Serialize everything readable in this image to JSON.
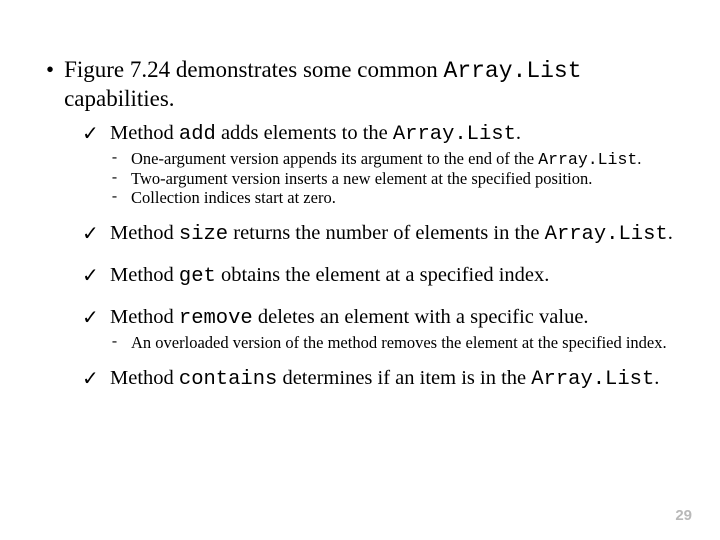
{
  "main": {
    "text_a": "Figure 7.24 demonstrates some common ",
    "code_a": "Array.List",
    "text_b": " capabilities."
  },
  "items": [
    {
      "pre": "Method ",
      "code": "add",
      "post": " adds elements to the ",
      "tail_code": "Array.List",
      "tail": ".",
      "subs": [
        {
          "pre": "One-argument version appends its argument to the end of the ",
          "code": "Array.List",
          "post": "."
        },
        {
          "pre": "Two-argument version inserts a new element at the specified position.",
          "code": "",
          "post": ""
        },
        {
          "pre": "Collection indices start at zero.",
          "code": "",
          "post": ""
        }
      ]
    },
    {
      "pre": "Method ",
      "code": "size",
      "post": " returns the number of elements in the ",
      "tail_code": "Array.List",
      "tail": ".",
      "subs": []
    },
    {
      "pre": "Method ",
      "code": "get",
      "post": " obtains the element at a specified index.",
      "tail_code": "",
      "tail": "",
      "subs": []
    },
    {
      "pre": "Method ",
      "code": "remove",
      "post": " deletes an element with a specific value.",
      "tail_code": "",
      "tail": "",
      "subs": [
        {
          "pre": "An overloaded version of the method removes the element at the specified index.",
          "code": "",
          "post": ""
        }
      ]
    },
    {
      "pre": "Method ",
      "code": "contains",
      "post": " determines if an item is in the ",
      "tail_code": "Array.List",
      "tail": ".",
      "subs": []
    }
  ],
  "page": "29"
}
